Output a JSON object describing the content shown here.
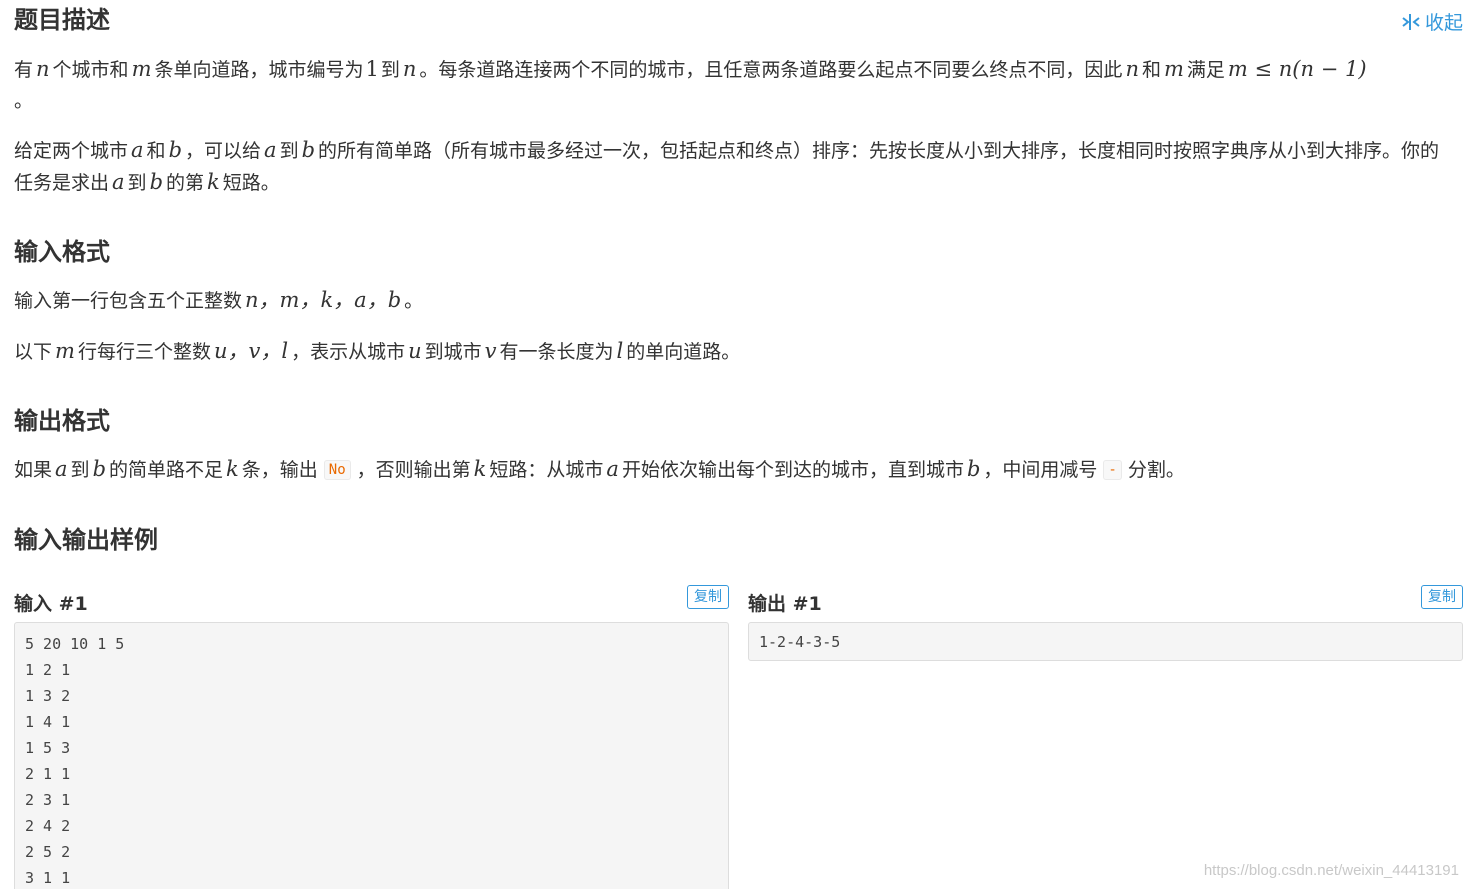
{
  "collapse": {
    "label": "收起",
    "icon": "collapse-icon"
  },
  "description": {
    "heading": "题目描述",
    "p1_t1": "有",
    "p1_n": "n",
    "p1_t2": "个城市和",
    "p1_m": "m",
    "p1_t3": "条单向道路，城市编号为",
    "p1_one": "1",
    "p1_t4": "到",
    "p1_n2": "n",
    "p1_t5": "。每条道路连接两个不同的城市，且任意两条道路要么起点不同要么终点不同，因此",
    "p1_n3": "n",
    "p1_t6": "和",
    "p1_m2": "m",
    "p1_t7": "满足",
    "p1_formula": "m ≤ n(n − 1)",
    "p1_end": "。",
    "p2_t1": "给定两个城市",
    "p2_a": "a",
    "p2_t2": "和",
    "p2_b": "b",
    "p2_t3": "，可以给",
    "p2_a2": "a",
    "p2_t4": "到",
    "p2_b2": "b",
    "p2_t5": "的所有简单路（所有城市最多经过一次，包括起点和终点）排序：先按长度从小到大排序，长度相同时按照字典序从小到大排序。你的任务是求出",
    "p2_a3": "a",
    "p2_t6": "到",
    "p2_b3": "b",
    "p2_t7": "的第",
    "p2_k": "k",
    "p2_t8": "短路。"
  },
  "input_format": {
    "heading": "输入格式",
    "p1_t1": "输入第一行包含五个正整数",
    "p1_vars": "n，m，k，a，b",
    "p1_end": "。",
    "p2_t1": "以下",
    "p2_m": "m",
    "p2_t2": "行每行三个整数",
    "p2_vars": "u，v，l",
    "p2_t3": "，表示从城市",
    "p2_u": "u",
    "p2_t4": "到城市",
    "p2_v": "v",
    "p2_t5": "有一条长度为",
    "p2_l": "l",
    "p2_t6": "的单向道路。"
  },
  "output_format": {
    "heading": "输出格式",
    "t1": "如果",
    "a": "a",
    "t2": "到",
    "b": "b",
    "t3": "的简单路不足",
    "k": "k",
    "t4": "条，输出",
    "code_no": "No",
    "t5": "，否则输出第",
    "k2": "k",
    "t6": "短路：从城市",
    "a2": "a",
    "t7": "开始依次输出每个到达的城市，直到城市",
    "b2": "b",
    "t8": "，中间用减号",
    "code_minus": "-",
    "t9": "分割。"
  },
  "samples": {
    "heading": "输入输出样例",
    "input_label": "输入 #1",
    "output_label": "输出 #1",
    "copy_label": "复制",
    "input_text": "5 20 10 1 5\n1 2 1\n1 3 2\n1 4 1\n1 5 3\n2 1 1\n2 3 1\n2 4 2\n2 5 2\n3 1 1",
    "output_text": "1-2-4-3-5"
  },
  "watermark": "https://blog.csdn.net/weixin_44413191",
  "colors": {
    "accent": "#3498db",
    "code": "#e96900",
    "text": "#333333"
  }
}
